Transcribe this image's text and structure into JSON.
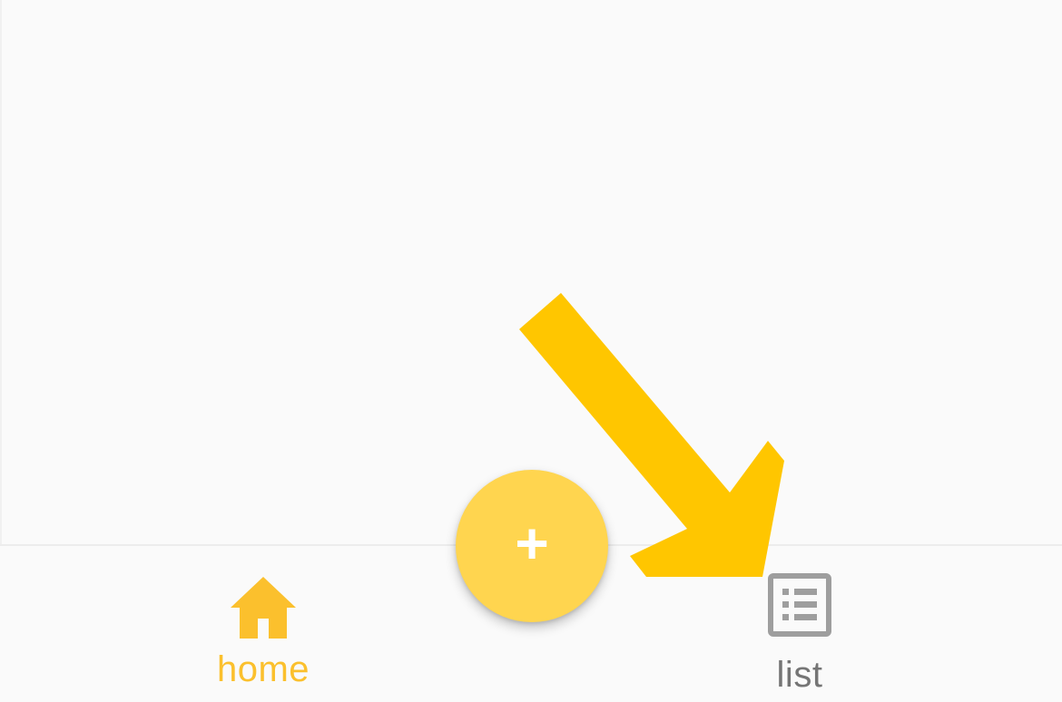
{
  "bottom_nav": {
    "items": [
      {
        "label": "home",
        "icon": "home-icon",
        "active": true,
        "color": "#fbc02d"
      },
      {
        "label": "list",
        "icon": "list-icon",
        "active": false,
        "color": "#757575"
      }
    ]
  },
  "fab": {
    "glyph": "+",
    "icon": "add-icon",
    "color": "#ffd54f"
  },
  "annotation": {
    "icon": "arrow-icon",
    "color": "#ffc600"
  }
}
